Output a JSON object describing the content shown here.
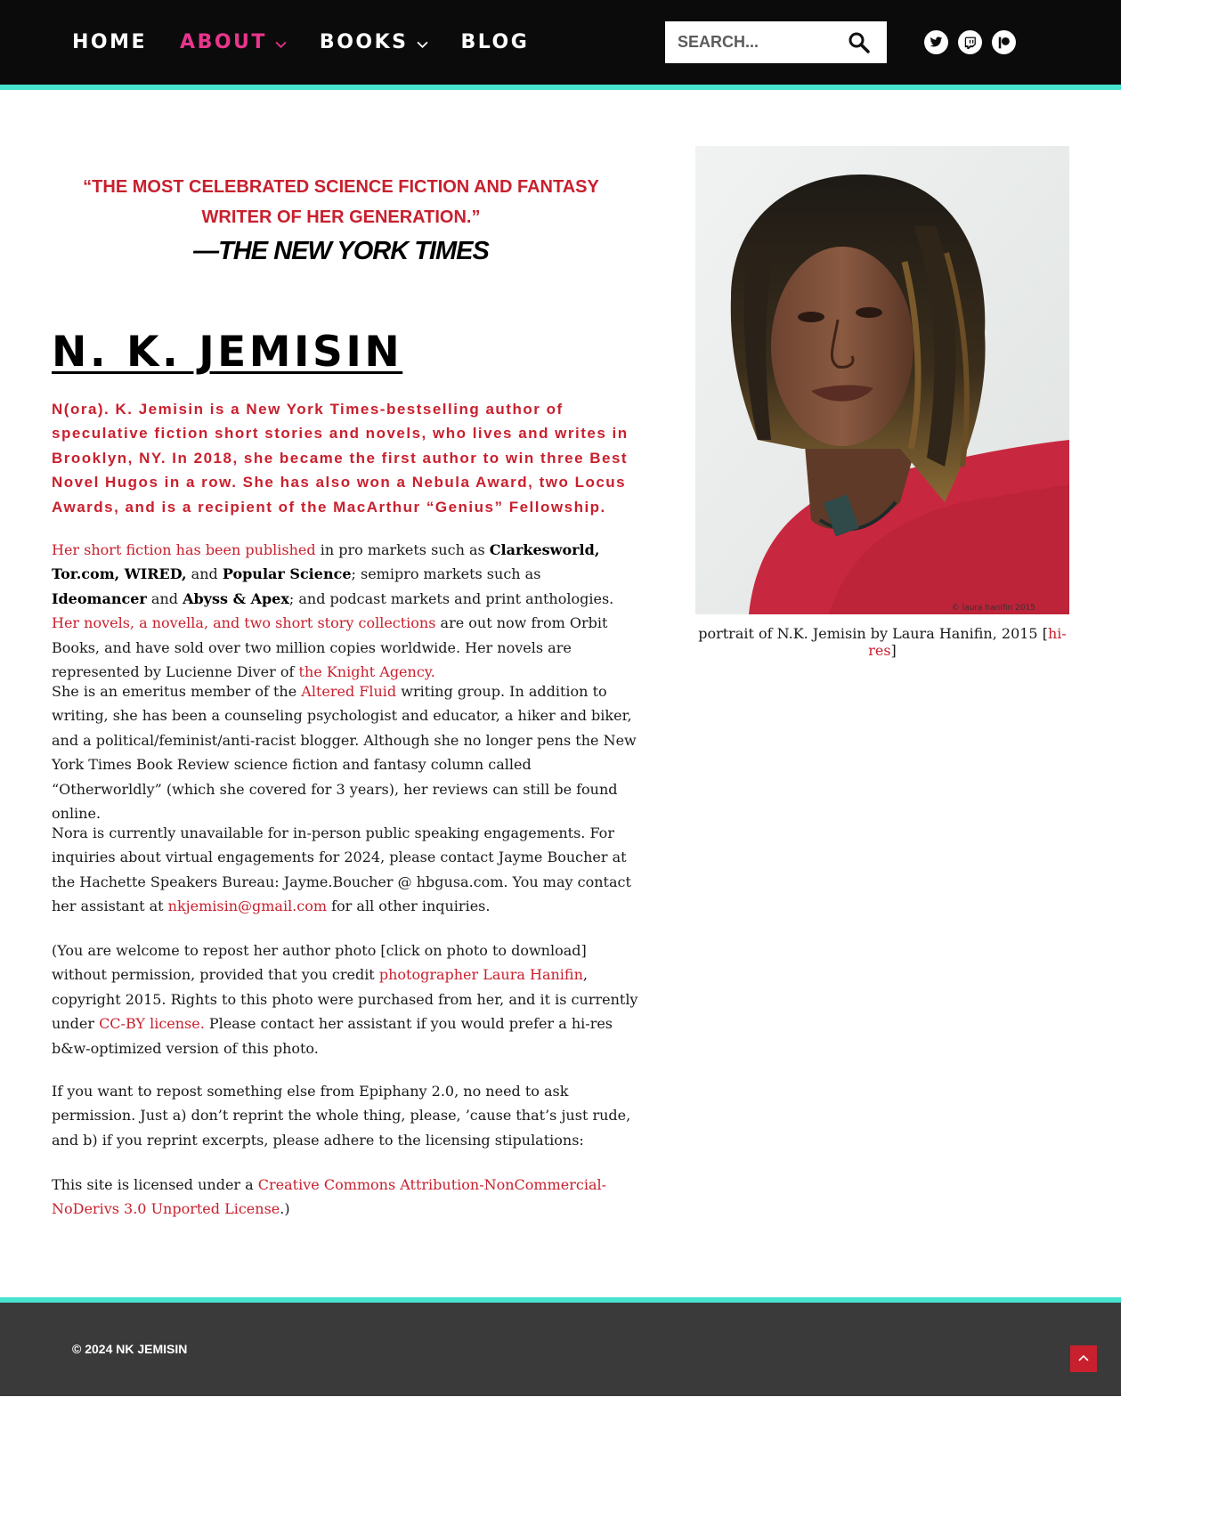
{
  "colors": {
    "accent_red": "#c8202e",
    "nav_active": "#e8358d",
    "stripe": "#46e3cf",
    "header_bg": "#0b0b0b",
    "footer_bg": "#3a3a3a"
  },
  "nav": {
    "items": [
      {
        "label": "HOME",
        "active": false,
        "has_dropdown": false
      },
      {
        "label": "ABOUT",
        "active": true,
        "has_dropdown": true
      },
      {
        "label": "BOOKS",
        "active": false,
        "has_dropdown": true
      },
      {
        "label": "BLOG",
        "active": false,
        "has_dropdown": false
      }
    ],
    "search_placeholder": "SEARCH...",
    "social_icons": [
      "twitter-icon",
      "twitch-icon",
      "patreon-icon"
    ]
  },
  "quote": {
    "text": "“THE MOST CELEBRATED SCIENCE FICTION AND FANTASY WRITER OF HER GENERATION.”",
    "source": "—THE NEW YORK TIMES"
  },
  "page_title": "N. K. JEMISIN",
  "lead": "N(ora). K. Jemisin is a New York Times-bestselling author of speculative fiction short stories and novels, who lives and writes in Brooklyn, NY. In 2018, she became the first author to win three Best Novel Hugos in a row. She has also won a Nebula Award, two Locus Awards, and is a recipient of the MacArthur “Genius” Fellowship.",
  "p1": {
    "link_short_fiction": "Her short fiction has been published",
    "t1": " in pro markets such as ",
    "b1": "Clarkesworld, Tor.com, WIRED,",
    "t2": " and ",
    "b2": "Popular Science",
    "t3": "; semipro markets such as ",
    "b3": "Ideomancer",
    "t4": " and ",
    "b4": "Abyss & Apex",
    "t5": "; and podcast markets and print anthologies. ",
    "link_novels": "Her novels, a novella, and two short story collections",
    "t6": " are out now from Orbit Books, and have sold over two million copies worldwide. Her novels are represented by Lucienne Diver of ",
    "link_agency": "the Knight Agency."
  },
  "p2": {
    "t1": "She is an emeritus member of the ",
    "link_altered_fluid": "Altered Fluid",
    "t2": " writing group. In addition to writing, she has been a counseling psychologist and educator, a hiker and biker, and a political/feminist/anti-racist blogger. Although she no longer pens the New York Times Book Review science fiction and fantasy column called “Otherworldly” (which she covered for 3 years), her reviews can still be found online."
  },
  "p3": {
    "t1": "Nora is currently unavailable for in-person public speaking engagements. For inquiries about virtual engagements for 2024, please contact Jayme Boucher at the Hachette Speakers Bureau: Jayme.Boucher @ hbgusa.com. You may contact her assistant at ",
    "link_email": "nkjemisin@gmail.com",
    "t2": " for all other inquiries."
  },
  "p4": {
    "t1": "(You are welcome to repost her author photo [click on photo to download] without permission, provided that you credit ",
    "link_photographer": "photographer Laura Hanifin",
    "t2": ", copyright 2015. Rights to this photo were purchased from her, and it is currently under ",
    "link_license": "CC-BY license.",
    "t3": " Please contact her assistant if you would prefer a hi-res b&w-optimized version of this photo."
  },
  "p5": {
    "t1": "If you want to repost something else from Epiphany 2.0, no need to ask permission. Just a) don’t reprint the whole thing, please, ’cause that’s just rude, and b) if you reprint excerpts, please adhere to the licensing stipulations:"
  },
  "p6": {
    "t1": "This site is licensed under a ",
    "link_cc": "Creative Commons Attribution-NonCommercial-NoDerivs 3.0 Unported License",
    "t2": ".)"
  },
  "photo": {
    "credit": "© laura hanifin 2015",
    "caption_text": "portrait of N.K. Jemisin by Laura Hanifin, 2015 [",
    "caption_link": "hi-res",
    "caption_end": "]"
  },
  "footer": {
    "copyright": "© 2024 NK JEMISIN"
  }
}
